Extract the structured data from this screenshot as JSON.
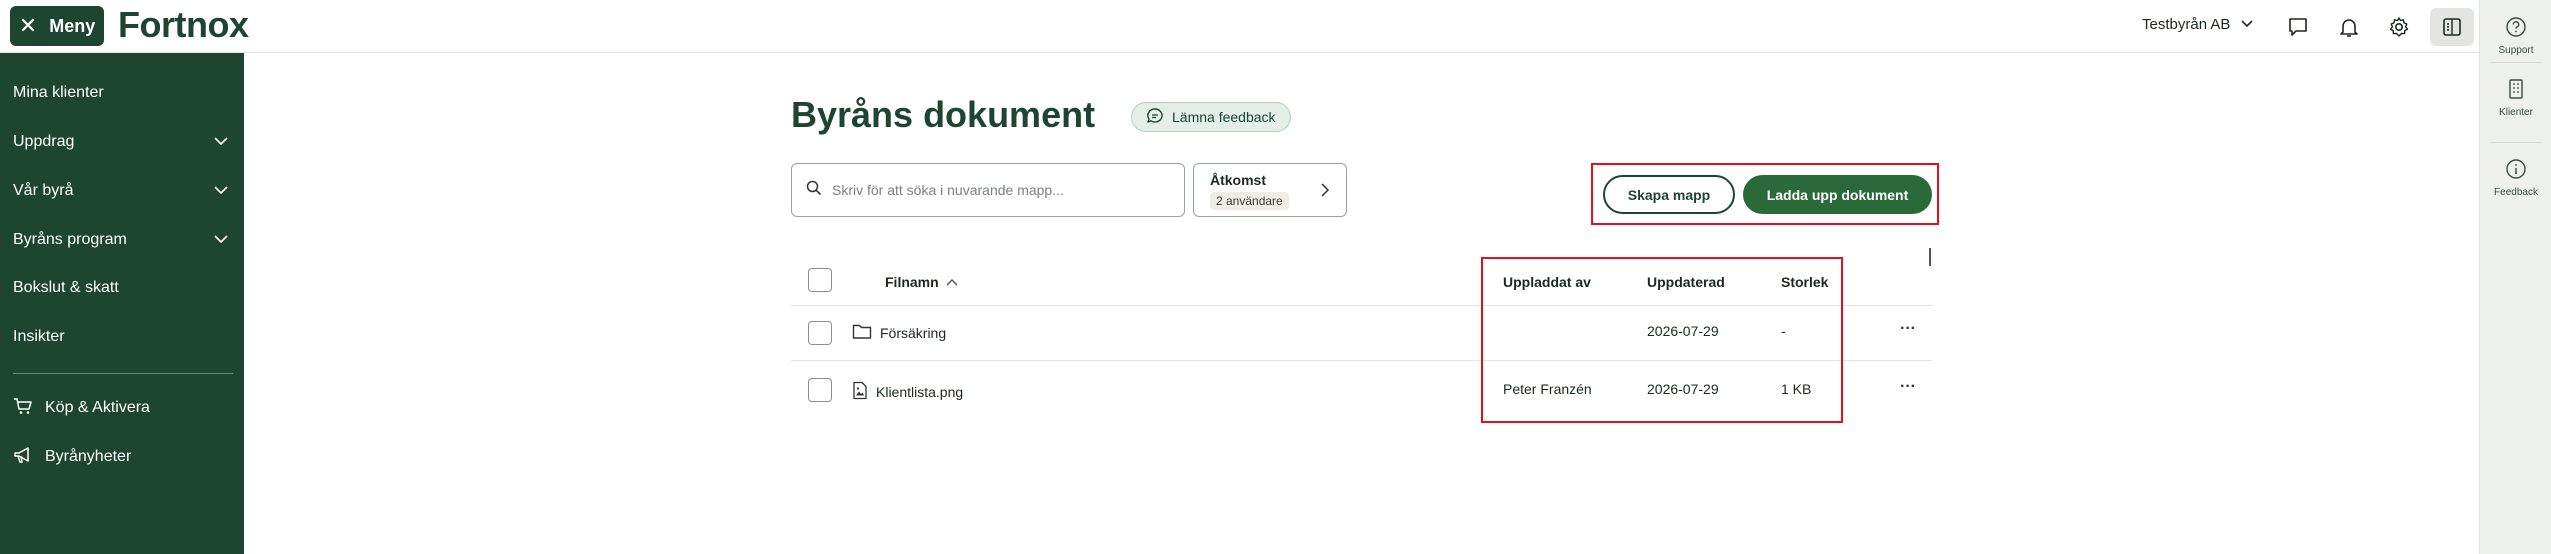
{
  "topbar": {
    "menu_label": "Meny",
    "logo": "Fortnox",
    "company": "Testbyrån AB",
    "icons": [
      "chat-icon",
      "bell-icon",
      "gear-icon",
      "panel-icon"
    ]
  },
  "sidebar": {
    "items": [
      {
        "label": "Mina klienter",
        "expandable": false
      },
      {
        "label": "Uppdrag",
        "expandable": true
      },
      {
        "label": "Vår byrå",
        "expandable": true
      },
      {
        "label": "Byråns program",
        "expandable": true
      },
      {
        "label": "Bokslut & skatt",
        "expandable": false
      },
      {
        "label": "Insikter",
        "expandable": false
      }
    ],
    "bottom_items": [
      {
        "label": "Köp & Aktivera",
        "icon": "cart-icon"
      },
      {
        "label": "Byrånyheter",
        "icon": "megaphone-icon"
      }
    ]
  },
  "rail": {
    "items": [
      {
        "label": "Support",
        "icon": "question-icon"
      },
      {
        "label": "Klienter",
        "icon": "building-icon"
      },
      {
        "label": "Feedback",
        "icon": "info-icon"
      }
    ]
  },
  "main": {
    "title": "Byråns dokument",
    "feedback_label": "Lämna feedback",
    "search_placeholder": "Skriv för att söka i nuvarande mapp...",
    "access": {
      "title": "Åtkomst",
      "badge": "2 användare"
    },
    "create_folder_label": "Skapa mapp",
    "upload_label": "Ladda upp dokument"
  },
  "table": {
    "headers": {
      "filename": "Filnamn",
      "uploaded_by": "Uppladdat av",
      "updated": "Uppdaterad",
      "size": "Storlek"
    },
    "rows": [
      {
        "type": "folder",
        "name": "Försäkring",
        "uploaded_by": "",
        "updated": "2026-07-29",
        "size": "-"
      },
      {
        "type": "file",
        "name": "Klientlista.png",
        "uploaded_by": "Peter Franzén",
        "updated": "2026-07-29",
        "size": "1 KB"
      }
    ],
    "row_menu": "···"
  },
  "colors": {
    "brand": "#1d4530",
    "primary_button": "#2a6a38",
    "highlight": "#e1111d"
  }
}
